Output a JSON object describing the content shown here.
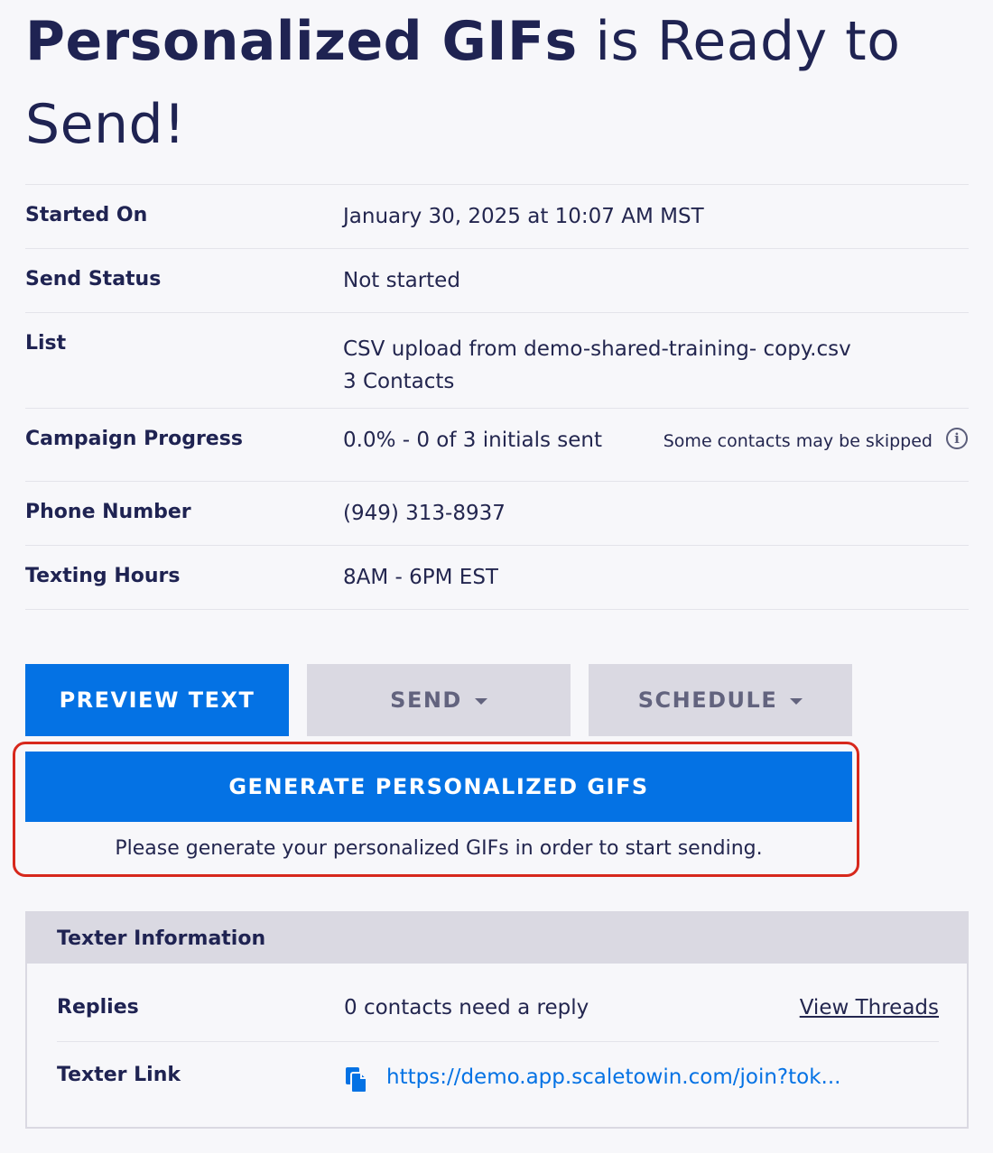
{
  "header": {
    "title_bold": "Personalized GIFs",
    "title_rest": " is Ready to Send!"
  },
  "details": [
    {
      "label": "Started On",
      "value": "January 30, 2025 at 10:07 AM MST"
    },
    {
      "label": "Send Status",
      "value": "Not started"
    },
    {
      "label": "List",
      "value": "CSV upload from demo-shared-training- copy.csv",
      "value2": "3 Contacts"
    },
    {
      "label": "Campaign Progress",
      "value": "0.0% - 0 of 3 initials sent",
      "note": "Some contacts may be skipped"
    },
    {
      "label": "Phone Number",
      "value": "(949) 313-8937"
    },
    {
      "label": "Texting Hours",
      "value": "8AM - 6PM EST"
    }
  ],
  "actions": {
    "preview": "PREVIEW TEXT",
    "send": "SEND",
    "schedule": "SCHEDULE",
    "generate": "GENERATE PERSONALIZED GIFS",
    "generate_note": "Please generate your personalized GIFs in order to start sending."
  },
  "texter_info": {
    "header": "Texter Information",
    "replies_label": "Replies",
    "replies_value": "0 contacts need a reply",
    "view_threads": "View Threads",
    "link_label": "Texter Link",
    "link_value": "https://demo.app.scaletowin.com/join?tok..."
  },
  "colors": {
    "primary": "#0472e4",
    "muted_button": "#dad9e2",
    "highlight": "#d7281c",
    "text": "#1f2352"
  },
  "icons": [
    "info-icon",
    "caret-down-icon",
    "copy-icon"
  ]
}
